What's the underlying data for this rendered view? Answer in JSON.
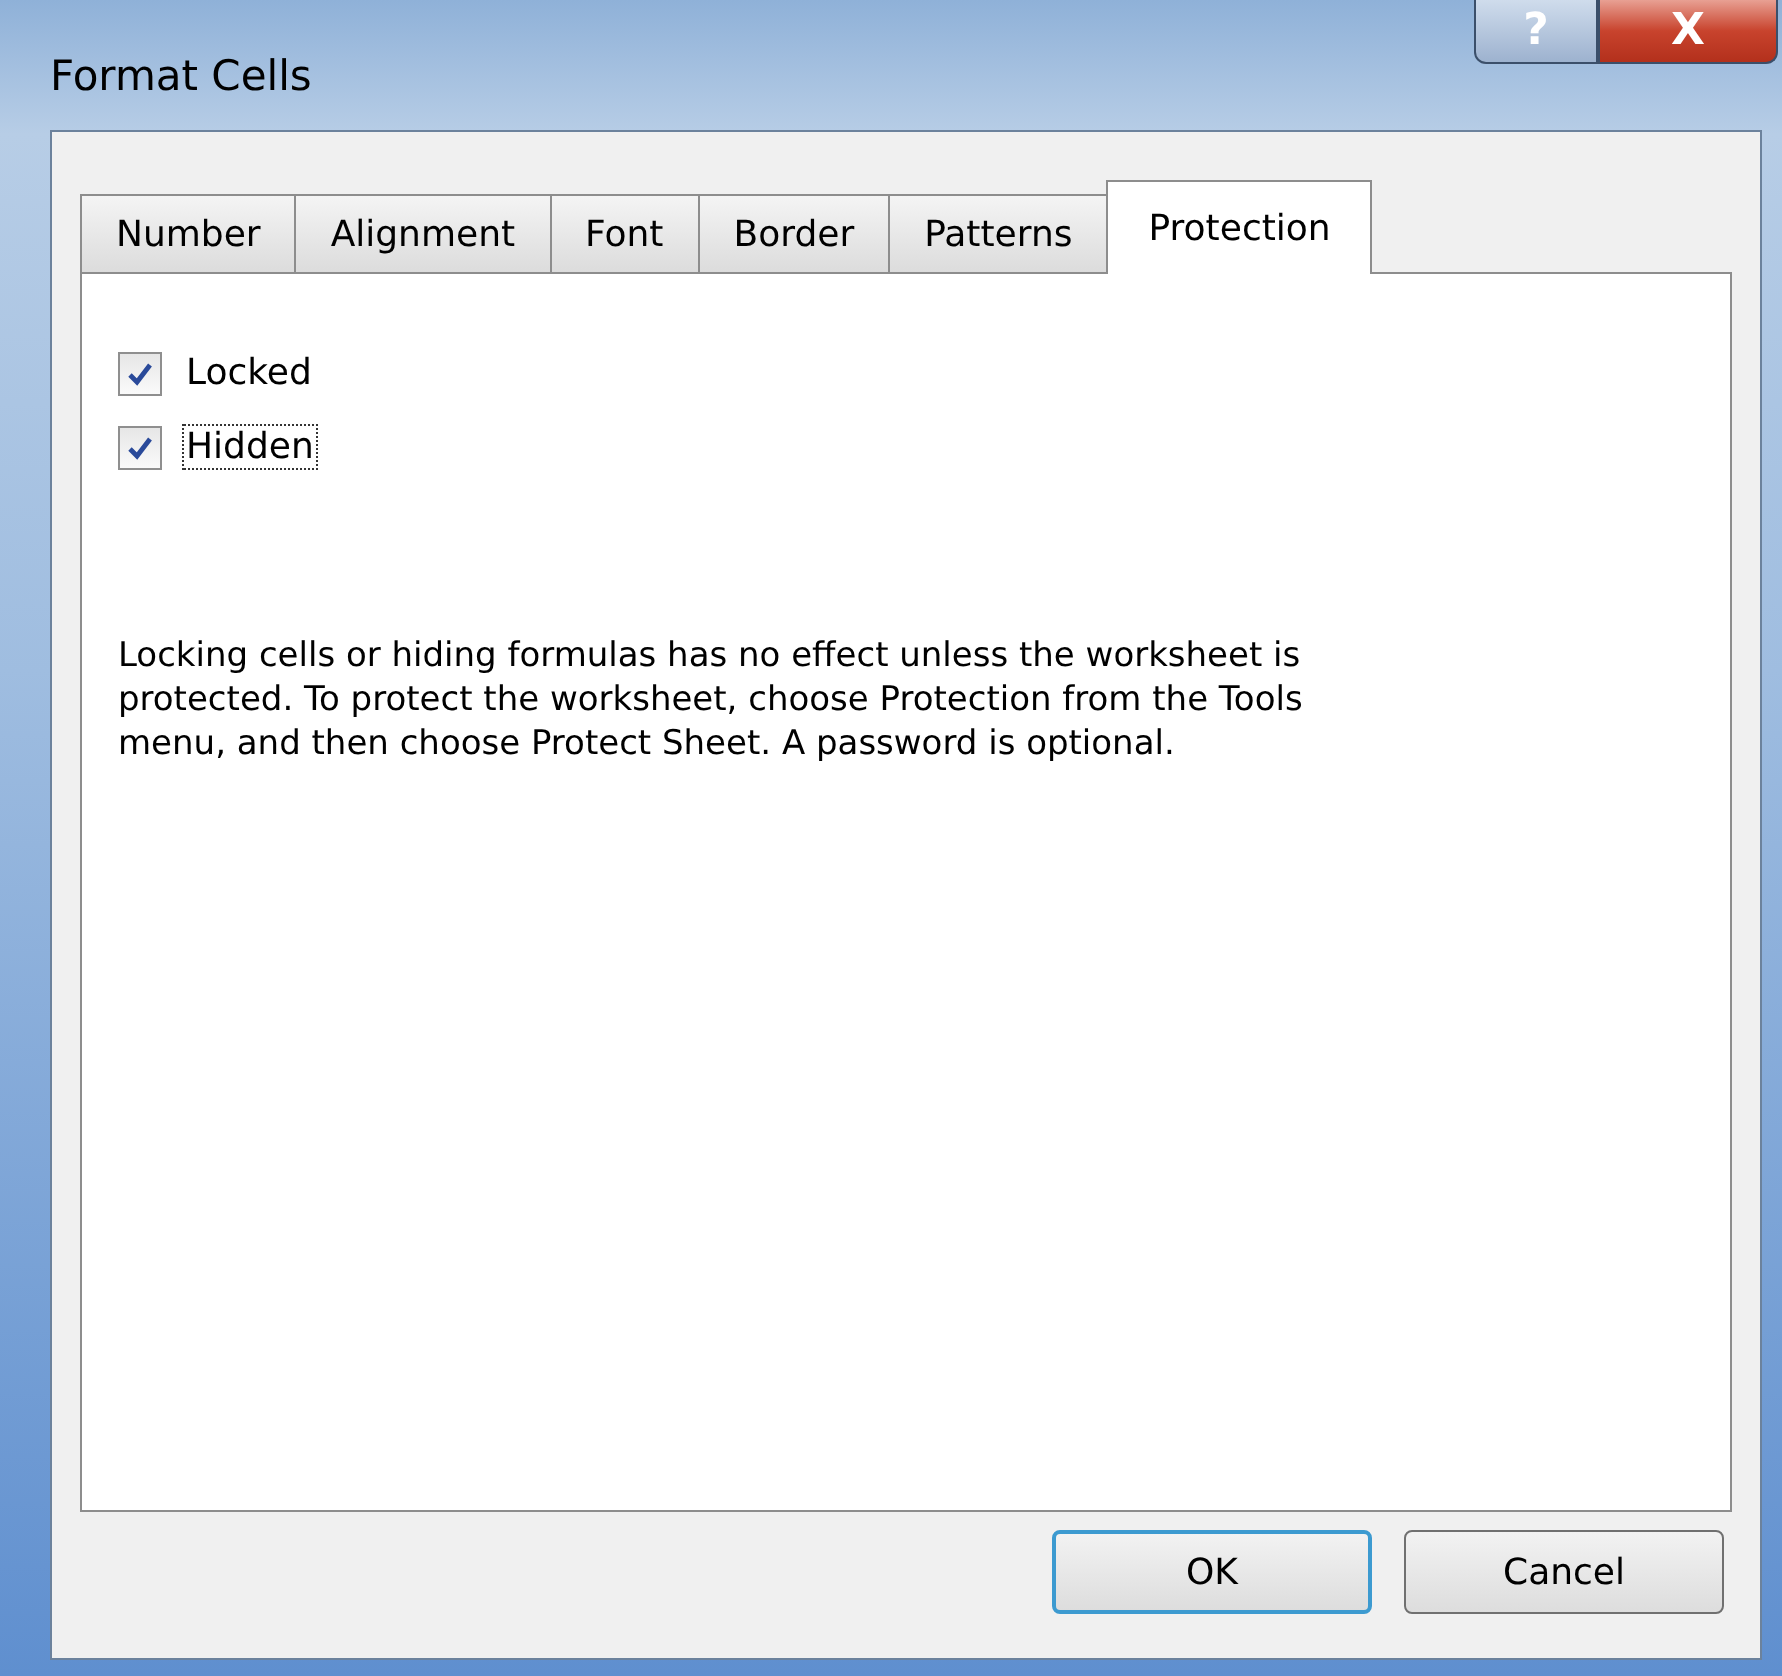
{
  "window": {
    "title": "Format Cells",
    "controls": [
      {
        "kind": "help",
        "label": "?"
      },
      {
        "kind": "close",
        "label": "X"
      }
    ]
  },
  "tabs": [
    {
      "label": "Number",
      "selected": false
    },
    {
      "label": "Alignment",
      "selected": false
    },
    {
      "label": "Font",
      "selected": false
    },
    {
      "label": "Border",
      "selected": false
    },
    {
      "label": "Patterns",
      "selected": false
    },
    {
      "label": "Protection",
      "selected": true
    }
  ],
  "options": [
    {
      "label": "Locked",
      "checked": true,
      "focused": false
    },
    {
      "label": "Hidden",
      "checked": true,
      "focused": true
    }
  ],
  "note": "Locking cells or hiding formulas has no effect unless the worksheet is protected. To protect the worksheet, choose Protection from the Tools menu, and then choose Protect Sheet. A password is optional.",
  "buttons": [
    {
      "label": "OK",
      "default": true
    },
    {
      "label": "Cancel",
      "default": false
    }
  ]
}
